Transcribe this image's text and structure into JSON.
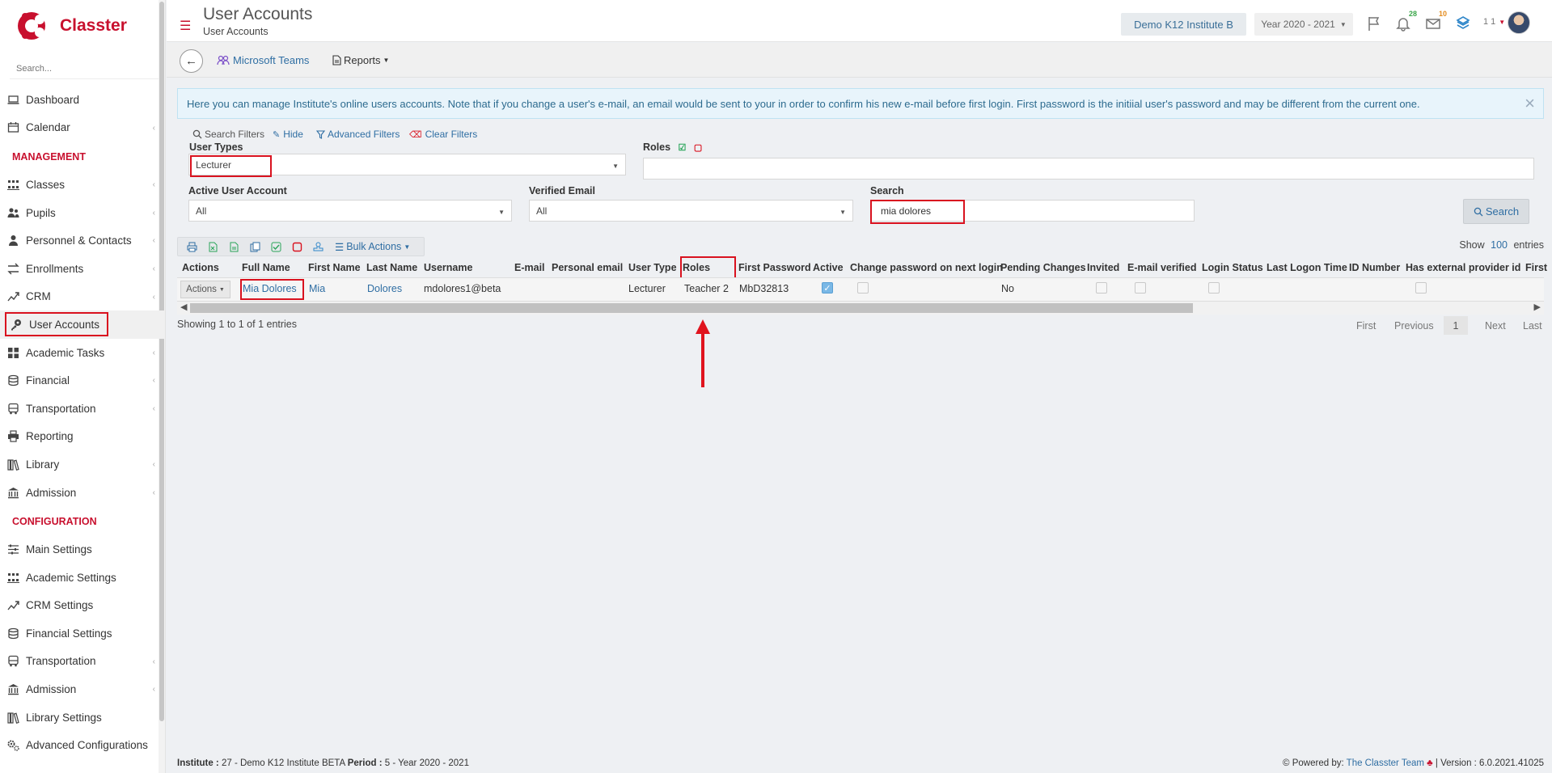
{
  "brand": {
    "name": "Classter",
    "color": "#c8102e"
  },
  "sidebar": {
    "search_placeholder": "Search...",
    "items_top": [
      {
        "label": "Dashboard",
        "icon": "laptop-icon"
      },
      {
        "label": "Calendar",
        "icon": "calendar-icon"
      }
    ],
    "section_management": "MANAGEMENT",
    "items_management": [
      {
        "label": "Classes",
        "icon": "classes-icon"
      },
      {
        "label": "Pupils",
        "icon": "pupils-icon"
      },
      {
        "label": "Personnel & Contacts",
        "icon": "person-icon"
      },
      {
        "label": "Enrollments",
        "icon": "swap-icon"
      },
      {
        "label": "CRM",
        "icon": "crm-icon"
      },
      {
        "label": "User Accounts",
        "icon": "user-key-icon",
        "active": true
      },
      {
        "label": "Academic Tasks",
        "icon": "grid-icon"
      },
      {
        "label": "Financial",
        "icon": "coins-icon"
      },
      {
        "label": "Transportation",
        "icon": "bus-icon"
      },
      {
        "label": "Reporting",
        "icon": "printer-icon"
      },
      {
        "label": "Library",
        "icon": "books-icon"
      },
      {
        "label": "Admission",
        "icon": "institution-icon"
      }
    ],
    "section_configuration": "CONFIGURATION",
    "items_configuration": [
      {
        "label": "Main Settings",
        "icon": "sliders-icon"
      },
      {
        "label": "Academic Settings",
        "icon": "classes-icon"
      },
      {
        "label": "CRM Settings",
        "icon": "crm-icon"
      },
      {
        "label": "Financial Settings",
        "icon": "coins-icon"
      },
      {
        "label": "Transportation",
        "icon": "bus-icon"
      },
      {
        "label": "Admission",
        "icon": "institution-icon"
      },
      {
        "label": "Library Settings",
        "icon": "books-icon"
      },
      {
        "label": "Advanced Configurations",
        "icon": "gears-icon"
      }
    ]
  },
  "header": {
    "title": "User Accounts",
    "breadcrumb": "User Accounts",
    "institute": "Demo K12 Institute B",
    "year": "Year 2020 - 2021",
    "notifications_count": "28",
    "messages_count": "10",
    "user_num": "1 1"
  },
  "toolbar": {
    "teams_label": "Microsoft Teams",
    "reports_label": "Reports"
  },
  "alert": {
    "text": "Here you can manage Institute's online users accounts. Note that if you change a user's e-mail, an email would be sent to your in order to confirm his new e-mail before first login. First password is the initiial user's password and may be different from the current one."
  },
  "filters": {
    "search_filters": "Search Filters",
    "hide": "Hide",
    "advanced": "Advanced Filters",
    "clear": "Clear Filters",
    "user_types_label": "User Types",
    "user_types_value": "Lecturer",
    "roles_label": "Roles",
    "active_label": "Active User Account",
    "active_value": "All",
    "verified_label": "Verified Email",
    "verified_value": "All",
    "search_label": "Search",
    "search_value": "mia dolores",
    "search_button": "Search"
  },
  "table": {
    "bulk_actions": "Bulk Actions",
    "show_label": "Show",
    "show_count": "100",
    "entries_label": "entries",
    "columns": [
      "Actions",
      "Full Name",
      "First Name",
      "Last Name",
      "Username",
      "E-mail",
      "Personal email",
      "User Type",
      "Roles",
      "First Password",
      "Active",
      "Change password on next login",
      "Pending Changes",
      "Invited",
      "E-mail verified",
      "Login Status",
      "Last Logon Time",
      "ID Number",
      "Has external provider id",
      "First"
    ],
    "row": {
      "actions": "Actions",
      "full_name": "Mia Dolores",
      "first_name": "Mia",
      "last_name": "Dolores",
      "username": "mdolores1@beta",
      "user_type": "Lecturer",
      "roles": "Teacher 2",
      "first_password": "MbD32813",
      "pending": "No"
    },
    "showing": "Showing 1 to 1 of 1 entries",
    "pager": {
      "first": "First",
      "previous": "Previous",
      "current": "1",
      "next": "Next",
      "last": "Last"
    }
  },
  "footer": {
    "institute_label": "Institute :",
    "institute_value": "27 - Demo K12 Institute BETA",
    "period_label": "Period :",
    "period_value": "5 - Year 2020 - 2021",
    "powered_by": "Powered by:",
    "team": "The Classter Team",
    "version": "| Version : 6.0.2021.41025"
  },
  "colors": {
    "accent": "#c8102e",
    "link": "#2f6ea3",
    "highlight": "#d9121f"
  }
}
